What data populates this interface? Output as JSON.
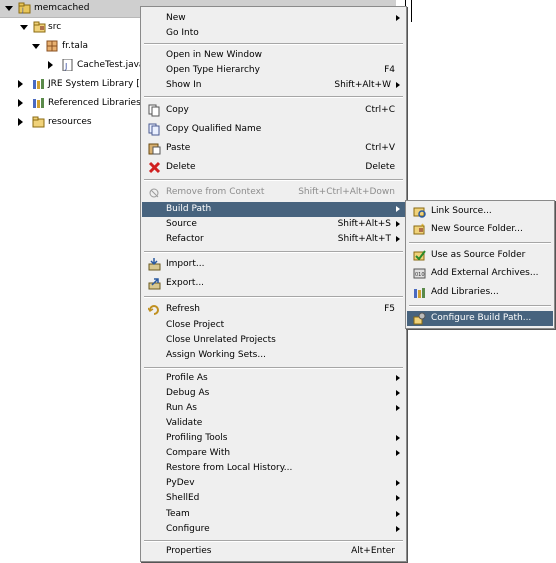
{
  "tree": {
    "root": "memcached",
    "src": "src",
    "package": "fr.tala",
    "file": "CacheTest.java",
    "jre": "JRE System Library [",
    "referenced": "Referenced Libraries",
    "resources": "resources"
  },
  "context_menu": {
    "items": [
      {
        "label": "New",
        "accel": "",
        "submenu": true
      },
      {
        "label": "Go Into",
        "accel": "",
        "submenu": false
      },
      {
        "label": "Open in New Window",
        "accel": "",
        "submenu": false
      },
      {
        "label": "Open Type Hierarchy",
        "accel": "F4",
        "submenu": false
      },
      {
        "label": "Show In",
        "accel": "Shift+Alt+W",
        "submenu": true
      },
      {
        "label": "Copy",
        "accel": "Ctrl+C",
        "submenu": false,
        "icon": "copy-icon"
      },
      {
        "label": "Copy Qualified Name",
        "accel": "",
        "submenu": false,
        "icon": "copy-qualified-icon"
      },
      {
        "label": "Paste",
        "accel": "Ctrl+V",
        "submenu": false,
        "icon": "paste-icon"
      },
      {
        "label": "Delete",
        "accel": "Delete",
        "submenu": false,
        "icon": "delete-icon"
      },
      {
        "label": "Remove from Context",
        "accel": "Shift+Ctrl+Alt+Down",
        "submenu": false,
        "disabled": true,
        "icon": "remove-context-icon"
      },
      {
        "label": "Build Path",
        "accel": "",
        "submenu": true,
        "highlighted": true
      },
      {
        "label": "Source",
        "accel": "Shift+Alt+S",
        "submenu": true
      },
      {
        "label": "Refactor",
        "accel": "Shift+Alt+T",
        "submenu": true
      },
      {
        "label": "Import...",
        "accel": "",
        "submenu": false,
        "icon": "import-icon"
      },
      {
        "label": "Export...",
        "accel": "",
        "submenu": false,
        "icon": "export-icon"
      },
      {
        "label": "Refresh",
        "accel": "F5",
        "submenu": false,
        "icon": "refresh-icon"
      },
      {
        "label": "Close Project",
        "accel": "",
        "submenu": false
      },
      {
        "label": "Close Unrelated Projects",
        "accel": "",
        "submenu": false
      },
      {
        "label": "Assign Working Sets...",
        "accel": "",
        "submenu": false
      },
      {
        "label": "Profile As",
        "accel": "",
        "submenu": true
      },
      {
        "label": "Debug As",
        "accel": "",
        "submenu": true
      },
      {
        "label": "Run As",
        "accel": "",
        "submenu": true
      },
      {
        "label": "Validate",
        "accel": "",
        "submenu": false
      },
      {
        "label": "Profiling Tools",
        "accel": "",
        "submenu": true
      },
      {
        "label": "Compare With",
        "accel": "",
        "submenu": true
      },
      {
        "label": "Restore from Local History...",
        "accel": "",
        "submenu": false
      },
      {
        "label": "PyDev",
        "accel": "",
        "submenu": true
      },
      {
        "label": "ShellEd",
        "accel": "",
        "submenu": true
      },
      {
        "label": "Team",
        "accel": "",
        "submenu": true
      },
      {
        "label": "Configure",
        "accel": "",
        "submenu": true
      },
      {
        "label": "Properties",
        "accel": "Alt+Enter",
        "submenu": false
      }
    ]
  },
  "build_path_submenu": {
    "items": [
      {
        "label": "Link Source...",
        "icon": "link-source-icon"
      },
      {
        "label": "New Source Folder...",
        "icon": "new-source-folder-icon"
      },
      {
        "label": "Use as Source Folder",
        "icon": "use-source-folder-icon"
      },
      {
        "label": "Add External Archives...",
        "icon": "external-archive-icon"
      },
      {
        "label": "Add Libraries...",
        "icon": "add-library-icon"
      },
      {
        "label": "Configure Build Path...",
        "icon": "configure-build-path-icon",
        "highlighted": true
      }
    ]
  },
  "colors": {
    "highlight": "#47637e",
    "menu_bg": "#efefef",
    "disabled_text": "#8d8d8d"
  }
}
